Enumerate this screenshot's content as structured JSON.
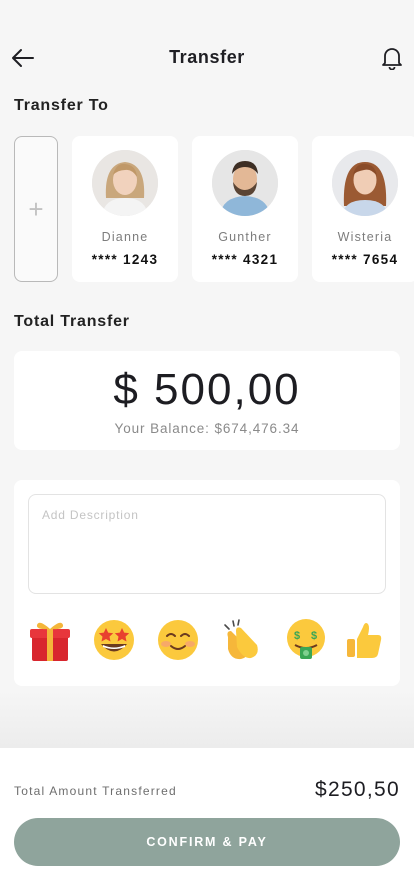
{
  "header": {
    "title": "Transfer",
    "back_icon": "arrow-left-icon",
    "notification_icon": "bell-icon"
  },
  "transfer_to": {
    "label": "Transfer To",
    "add_icon": "plus-icon",
    "contacts": [
      {
        "name": "Dianne",
        "account": "**** 1243"
      },
      {
        "name": "Gunther",
        "account": "**** 4321"
      },
      {
        "name": "Wisteria",
        "account": "**** 7654"
      }
    ]
  },
  "total_transfer": {
    "label": "Total Transfer",
    "amount": "$ 500,00",
    "balance": "Your Balance: $674,476.34"
  },
  "description": {
    "placeholder": "Add Description",
    "value": ""
  },
  "emojis": [
    "gift-icon",
    "star-struck-icon",
    "smiling-face-icon",
    "clapping-hands-icon",
    "money-mouth-icon",
    "thumbs-up-icon"
  ],
  "footer": {
    "total_label": "Total Amount Transferred",
    "total_value": "$250,50",
    "confirm_label": "CONFIRM & PAY"
  },
  "colors": {
    "accent": "#8fa49c",
    "background": "#f6f6f6",
    "card": "#ffffff",
    "text": "#1d1d22"
  }
}
